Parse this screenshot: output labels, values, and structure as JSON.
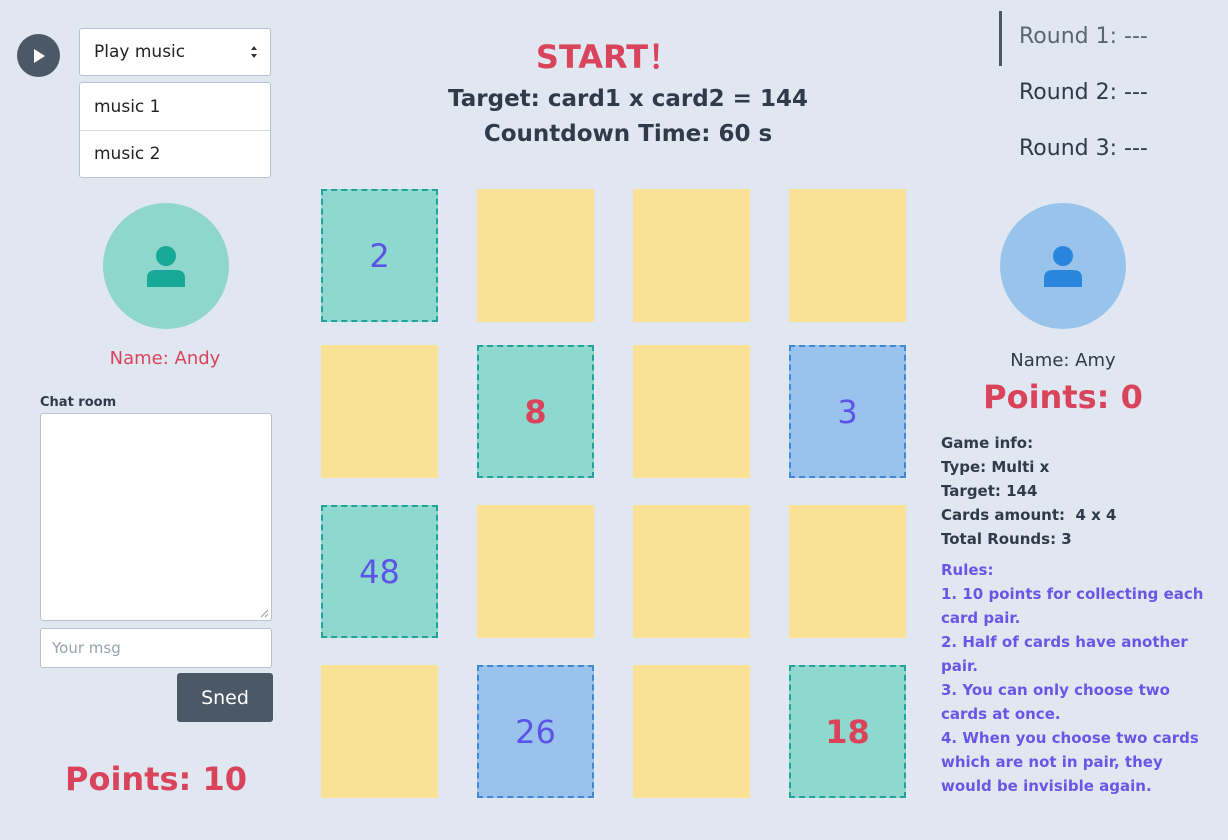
{
  "music": {
    "selected": "Play music",
    "options": [
      "music 1",
      "music 2"
    ]
  },
  "header": {
    "start": "START！",
    "target": "Target: card1 x card2 = 144",
    "countdown": "Countdown Time: 60 s"
  },
  "rounds": [
    "Round 1: ---",
    "Round 2: ---",
    "Round 3: ---"
  ],
  "player_left": {
    "name": "Name: Andy",
    "points": "Points: 10"
  },
  "player_right": {
    "name": "Name: Amy",
    "points": "Points: 0"
  },
  "chat": {
    "label": "Chat room",
    "input_placeholder": "Your msg",
    "send_label": "Sned"
  },
  "cards": [
    {
      "state": "teal",
      "value": "2",
      "color": "purple"
    },
    {
      "state": "hidden",
      "value": ""
    },
    {
      "state": "hidden",
      "value": ""
    },
    {
      "state": "hidden",
      "value": ""
    },
    {
      "state": "hidden",
      "value": ""
    },
    {
      "state": "teal",
      "value": "8",
      "color": "red"
    },
    {
      "state": "hidden",
      "value": ""
    },
    {
      "state": "blue",
      "value": "3",
      "color": "purple"
    },
    {
      "state": "teal",
      "value": "48",
      "color": "purple"
    },
    {
      "state": "hidden",
      "value": ""
    },
    {
      "state": "hidden",
      "value": ""
    },
    {
      "state": "hidden",
      "value": ""
    },
    {
      "state": "hidden",
      "value": ""
    },
    {
      "state": "blue",
      "value": "26",
      "color": "purple"
    },
    {
      "state": "hidden",
      "value": ""
    },
    {
      "state": "teal",
      "value": "18",
      "color": "red"
    }
  ],
  "game_info": {
    "title": "Game info:",
    "type": "Type: Multi x",
    "target": "Target: 144",
    "cards_amount": "Cards amount:  4 x 4",
    "total_rounds": "Total Rounds: 3"
  },
  "rules": {
    "title": "Rules:",
    "items": [
      "1. 10 points for collecting each card pair.",
      "2. Half of cards have another pair.",
      "3. You can only choose two cards at once.",
      "4. When you choose two cards which are not in pair, they would be invisible again."
    ]
  },
  "colors": {
    "background": "#e1e7f0",
    "accent_red": "#d9445c",
    "hidden_card": "#f9e196",
    "teal_card": "#8fd8cf",
    "blue_card": "#99c3ec",
    "rules_purple": "#6b55e6"
  }
}
